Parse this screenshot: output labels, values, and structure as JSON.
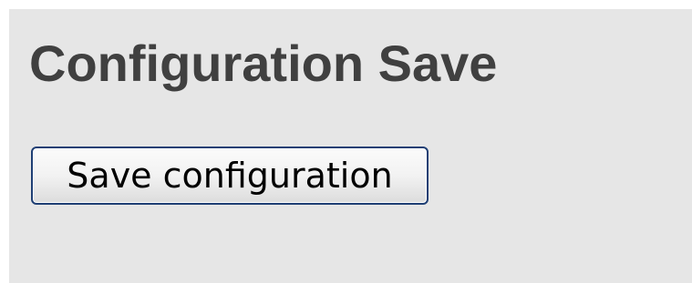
{
  "page": {
    "title": "Configuration Save"
  },
  "actions": {
    "save_label": "Save configuration"
  },
  "colors": {
    "panel_background": "#e6e6e6",
    "title_text": "#404040",
    "button_border": "#1f3f74"
  }
}
